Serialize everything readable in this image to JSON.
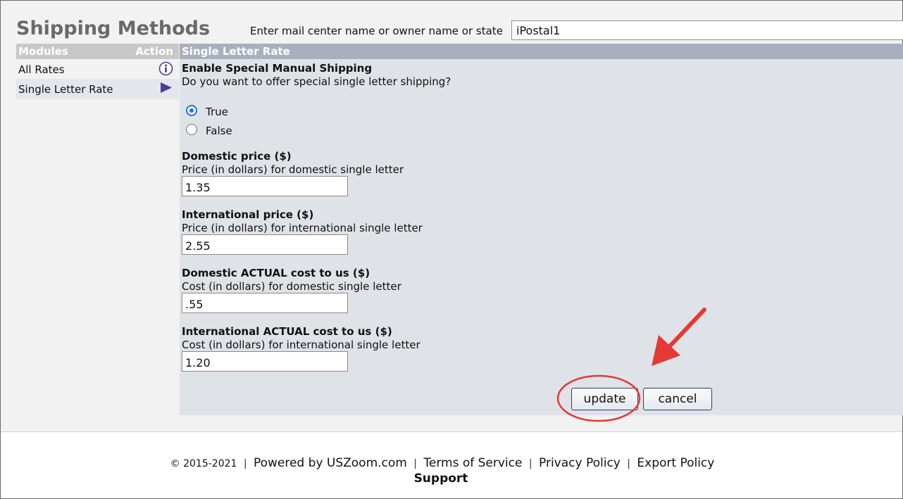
{
  "header": {
    "title": "Shipping Methods",
    "search_label": "Enter mail center name or owner name or state",
    "search_value": "iPostal1"
  },
  "sidebar": {
    "col_modules": "Modules",
    "col_action": "Action",
    "items": [
      {
        "label": "All Rates",
        "icon": "info-icon"
      },
      {
        "label": "Single Letter Rate",
        "icon": "play-arrow-icon"
      }
    ]
  },
  "panel": {
    "title": "Single Letter Rate",
    "enable": {
      "title": "Enable Special Manual Shipping",
      "description": "Do you want to offer special single letter shipping?",
      "options": [
        "True",
        "False"
      ],
      "selected": "True"
    },
    "fields": [
      {
        "title": "Domestic price ($)",
        "description": "Price (in dollars) for domestic single letter",
        "value": "1.35"
      },
      {
        "title": "International price ($)",
        "description": "Price (in dollars) for international single letter",
        "value": "2.55"
      },
      {
        "title": "Domestic ACTUAL cost to us ($)",
        "description": "Cost (in dollars) for domestic single letter",
        "value": ".55"
      },
      {
        "title": "International ACTUAL cost to us ($)",
        "description": "Cost (in dollars) for international single letter",
        "value": "1.20"
      }
    ],
    "buttons": {
      "update": "update",
      "cancel": "cancel"
    }
  },
  "footer": {
    "copyright": "© 2015-2021",
    "separator": "|",
    "links": [
      "Powered by USZoom.com",
      "Terms of Service",
      "Privacy Policy",
      "Export Policy"
    ],
    "support": "Support"
  },
  "colors": {
    "panel_header": "#a9b0bd",
    "panel_bg": "#dfe3e8",
    "annotation": "#e53935",
    "radio_selected": "#1a73e8",
    "icon_purple": "#4b3d9c"
  }
}
